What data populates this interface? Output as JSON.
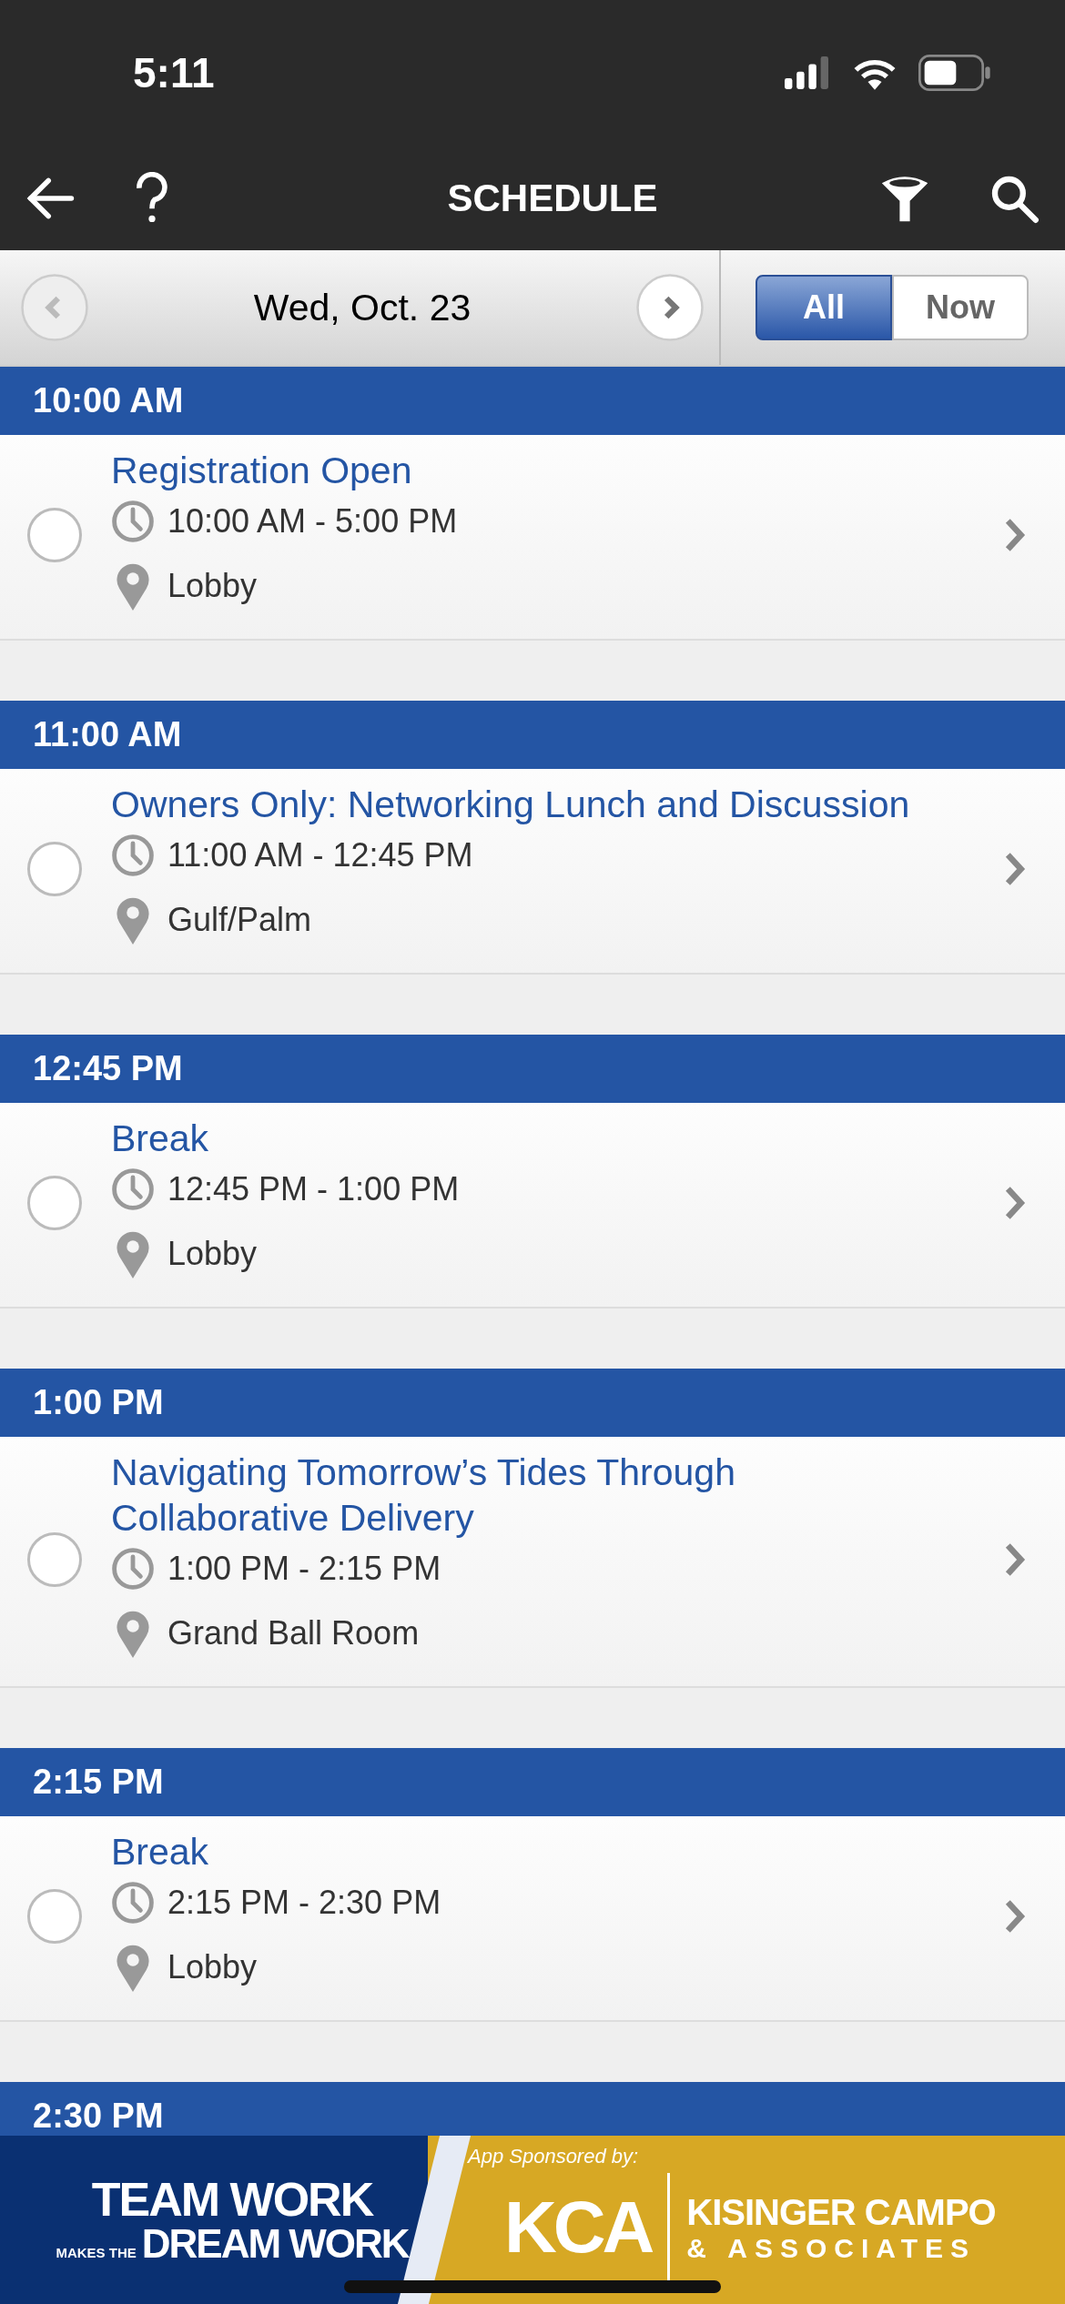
{
  "status_bar": {
    "time": "5:11"
  },
  "nav_bar": {
    "title": "SCHEDULE"
  },
  "date_bar": {
    "date": "Wed, Oct. 23",
    "segments": [
      {
        "label": "All",
        "selected": true
      },
      {
        "label": "Now",
        "selected": false
      }
    ]
  },
  "sections": [
    {
      "time": "10:00 AM",
      "sessions": [
        {
          "title": "Registration Open",
          "time": "10:00 AM - 5:00 PM",
          "location": "Lobby",
          "checked": false
        }
      ]
    },
    {
      "time": "11:00 AM",
      "sessions": [
        {
          "title": "Owners Only: Networking Lunch and Discussion",
          "time": "11:00 AM - 12:45 PM",
          "location": "Gulf/Palm",
          "checked": false
        }
      ]
    },
    {
      "time": "12:45 PM",
      "sessions": [
        {
          "title": "Break",
          "time": "12:45 PM - 1:00 PM",
          "location": "Lobby",
          "checked": false
        }
      ]
    },
    {
      "time": "1:00 PM",
      "sessions": [
        {
          "title": "Navigating Tomorrow’s Tides Through Collaborative Delivery",
          "time": "1:00 PM - 2:15 PM",
          "location": "Grand Ball Room",
          "checked": false
        }
      ]
    },
    {
      "time": "2:15 PM",
      "sessions": [
        {
          "title": "Break",
          "time": "2:15 PM - 2:30 PM",
          "location": "Lobby",
          "checked": false
        }
      ]
    },
    {
      "time": "2:30 PM"
    }
  ],
  "banner": {
    "slogan_top": "TEAM WORK",
    "slogan_small": "MAKES THE",
    "slogan_bottom": "DREAM WORK",
    "sponsored_label": "App Sponsored by:",
    "sponsor_mark": "KCA",
    "sponsor_name": "KISINGER CAMPO",
    "sponsor_name_2": "& ASSOCIATES"
  }
}
